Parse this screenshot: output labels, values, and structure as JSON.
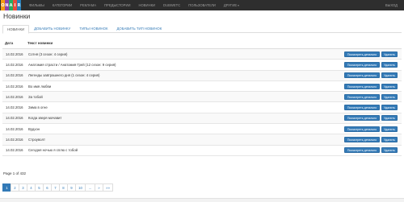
{
  "logo": {
    "letters": [
      {
        "char": "O",
        "color": "#f39c12"
      },
      {
        "char": "N",
        "color": "#8e44ad"
      },
      {
        "char": "A",
        "color": "#27ae60"
      },
      {
        "char": "I",
        "color": "#e74c3c"
      },
      {
        "char": "R",
        "color": "#2980b9"
      }
    ]
  },
  "nav": {
    "items": [
      "Фильмы",
      "Категории",
      "Реклама",
      "Предыстории",
      "Новинки",
      "Dubwetc",
      "Пользователи",
      "Другие"
    ],
    "logout": "Выход"
  },
  "page": {
    "title": "Новинки"
  },
  "tabs": [
    {
      "label": "Новинки",
      "active": true
    },
    {
      "label": "Добавить новинку",
      "active": false
    },
    {
      "label": "Типы новинок",
      "active": false
    },
    {
      "label": "Добавить тип новинок",
      "active": false
    }
  ],
  "table": {
    "headers": {
      "date": "Дата",
      "text": "Текст новинки"
    },
    "detail_label": "Посмотреть детально",
    "delete_label": "Удалить",
    "rows": [
      {
        "date": "14.02.2016",
        "text": "Сотня (3 сезон: 4 серия)"
      },
      {
        "date": "14.02.2016",
        "text": "Анатомия страсти / Анатомия Грей (12 сезон: 9 серия)"
      },
      {
        "date": "14.02.2016",
        "text": "Легенды завтрашнего дня (1 сезон: 4 серия)"
      },
      {
        "date": "14.02.2016",
        "text": "Во имя любви"
      },
      {
        "date": "14.02.2016",
        "text": "За тобой"
      },
      {
        "date": "14.02.2016",
        "text": "Зима в огне"
      },
      {
        "date": "14.02.2016",
        "text": "Когда зверя мочавит"
      },
      {
        "date": "14.02.2016",
        "text": "Вудхэн"
      },
      {
        "date": "14.02.2016",
        "text": "Строуволт"
      },
      {
        "date": "14.02.2016",
        "text": "Сегодня ночью я сплю с тобой"
      }
    ]
  },
  "pagination": {
    "info": "Page 1 of 432",
    "pages": [
      "1",
      "2",
      "3",
      "4",
      "5",
      "6",
      "7",
      "8",
      "9",
      "10",
      "...",
      "»",
      "»»"
    ],
    "active": "1"
  }
}
